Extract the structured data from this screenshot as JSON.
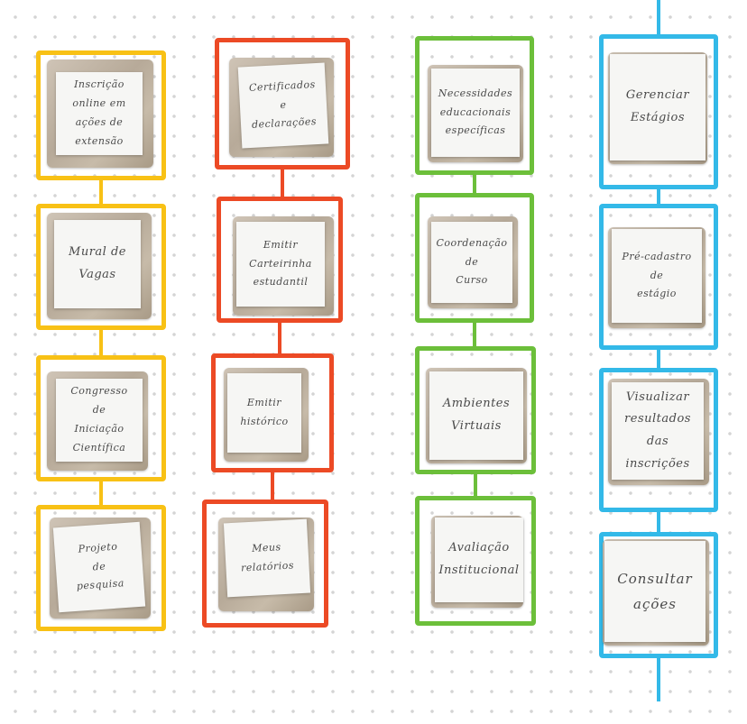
{
  "colors": {
    "yellow": "#f8c115",
    "red": "#ec4a25",
    "green": "#6cbf3a",
    "blue": "#33b9e8"
  },
  "columns": [
    {
      "id": "col-1",
      "color_key": "yellow",
      "cards": [
        {
          "text": "Inscrição\nonline em\nações de\nextensão"
        },
        {
          "text": "Mural de\nVagas"
        },
        {
          "text": "Congresso\nde\nIniciação\nCientífica"
        },
        {
          "text": "Projeto\nde\npesquisa"
        }
      ]
    },
    {
      "id": "col-2",
      "color_key": "red",
      "cards": [
        {
          "text": "Certificados\ne\ndeclarações"
        },
        {
          "text": "Emitir\nCarteirinha\nestudantil"
        },
        {
          "text": "Emitir\nhistórico"
        },
        {
          "text": "Meus\nrelatórios"
        }
      ]
    },
    {
      "id": "col-3",
      "color_key": "green",
      "cards": [
        {
          "text": "Necessidades\neducacionais\nespecíficas"
        },
        {
          "text": "Coordenação\nde\nCurso"
        },
        {
          "text": "Ambientes\nVirtuais"
        },
        {
          "text": "Avaliação\nInstitucional"
        }
      ]
    },
    {
      "id": "col-4",
      "color_key": "blue",
      "cards": [
        {
          "text": "Gerenciar\nEstágios"
        },
        {
          "text": "Pré-cadastro\nde\nestágio"
        },
        {
          "text": "Visualizar\nresultados\ndas inscrições"
        },
        {
          "text": "Consultar\nações"
        }
      ]
    }
  ]
}
